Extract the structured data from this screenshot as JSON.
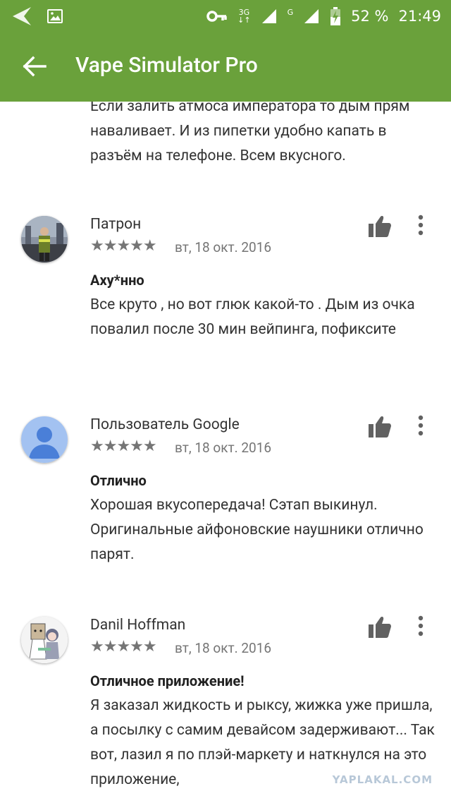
{
  "status_bar": {
    "network_3g": "3G",
    "network_g": "G",
    "battery": "52 %",
    "time": "21:49"
  },
  "app_bar": {
    "title": "Vape Simulator Pro"
  },
  "cut_review_text": "Если залить атмоса императора то дым прям наваливает. И из пипетки удобно капать в разъём на телефоне. Всем вкусного.",
  "reviews": [
    {
      "author": "Патрон",
      "stars": "★★★★★",
      "date": "вт, 18 окт. 2016",
      "title": "Аху*нно",
      "body": "Все круто , но вот глюк какой-то . Дым из очка повалил после 30 мин вейпинга, пофиксите",
      "rating": 5
    },
    {
      "author": "Пользователь Google",
      "stars": "★★★★★",
      "date": "вт, 18 окт. 2016",
      "title": "Отлично",
      "body": "Хорошая вкусопередача! Сэтап выкинул. Оригинальные айфоновские наушники отлично парят.",
      "rating": 5
    },
    {
      "author": "Danil Hoffman",
      "stars": "★★★★★",
      "date": "вт, 18 окт. 2016",
      "title": "Отличное приложение!",
      "body": "Я заказал жидкость и рыксу, жижка уже пришла, а посылку с самим девайсом задерживают... Так вот, лазил я по плэй-маркету и наткнулся на это приложение,",
      "rating": 5
    }
  ],
  "watermark": "YAPLAKAL.COM",
  "colors": {
    "accent": "#6aa13b",
    "text": "#333333",
    "meta": "#757575"
  }
}
